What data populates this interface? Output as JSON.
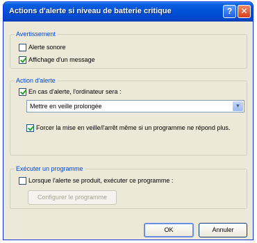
{
  "window": {
    "title": "Actions d'alerte si niveau de batterie critique",
    "help_glyph": "?",
    "close_glyph": "✕"
  },
  "warning_group": {
    "legend": "Avertissement",
    "sound_alarm": {
      "label": "Alerte sonore",
      "checked": false
    },
    "show_message": {
      "label": "Affichage d'un message",
      "checked": true
    }
  },
  "alarm_action_group": {
    "legend": "Action d'alerte",
    "on_alarm": {
      "label": "En cas d'alerte, l'ordinateur sera :",
      "checked": true
    },
    "action_select": {
      "value": "Mettre en veille prolongée",
      "arrow_glyph": "▼"
    },
    "force_standby": {
      "label": "Forcer la mise en veille/l'arrêt même si un programme ne répond plus.",
      "checked": true
    }
  },
  "run_program_group": {
    "legend": "Exécuter un programme",
    "run_on_alarm": {
      "label": "Lorsque l'alerte se produit, exécuter ce programme :",
      "checked": false
    },
    "configure_button": "Configurer le programme"
  },
  "buttons": {
    "ok": "OK",
    "cancel": "Annuler"
  }
}
